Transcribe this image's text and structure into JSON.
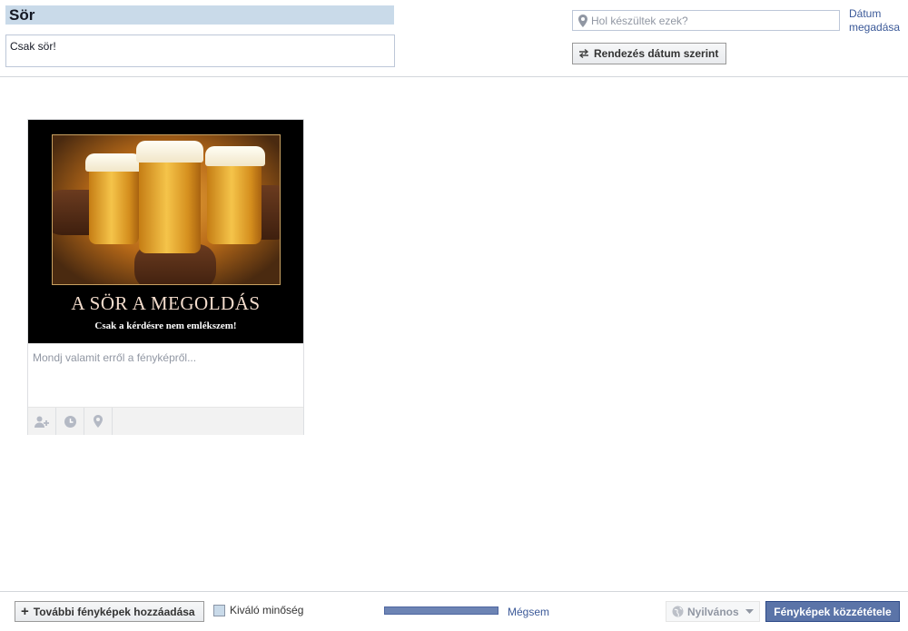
{
  "album": {
    "title": "Sör",
    "description": "Csak sör!"
  },
  "location": {
    "placeholder": "Hol készültek ezek?",
    "icon": "map-pin-icon"
  },
  "date_link": "Dátum megadása",
  "sort_button": {
    "label": "Rendezés dátum szerint",
    "icon": "swap-arrows-icon"
  },
  "photo": {
    "poster_title": "A SÖR A MEGOLDÁS",
    "poster_subtitle": "Csak a kérdésre nem emlékszem!",
    "caption_placeholder": "Mondj valamit erről a fényképről...",
    "tools": [
      "tag-person-icon",
      "clock-icon",
      "map-pin-icon"
    ]
  },
  "footer": {
    "add_photos": "További fényképek hozzáadása",
    "high_quality": "Kiváló minőség",
    "upload_progress": 1.0,
    "cancel": "Mégsem",
    "privacy": "Nyilvános",
    "publish": "Fényképek közzététele"
  },
  "colors": {
    "title_bg": "#c9dae9",
    "link": "#3b5998",
    "primary_button": "#5b74a8",
    "progress_fill": "#6d84b4"
  }
}
